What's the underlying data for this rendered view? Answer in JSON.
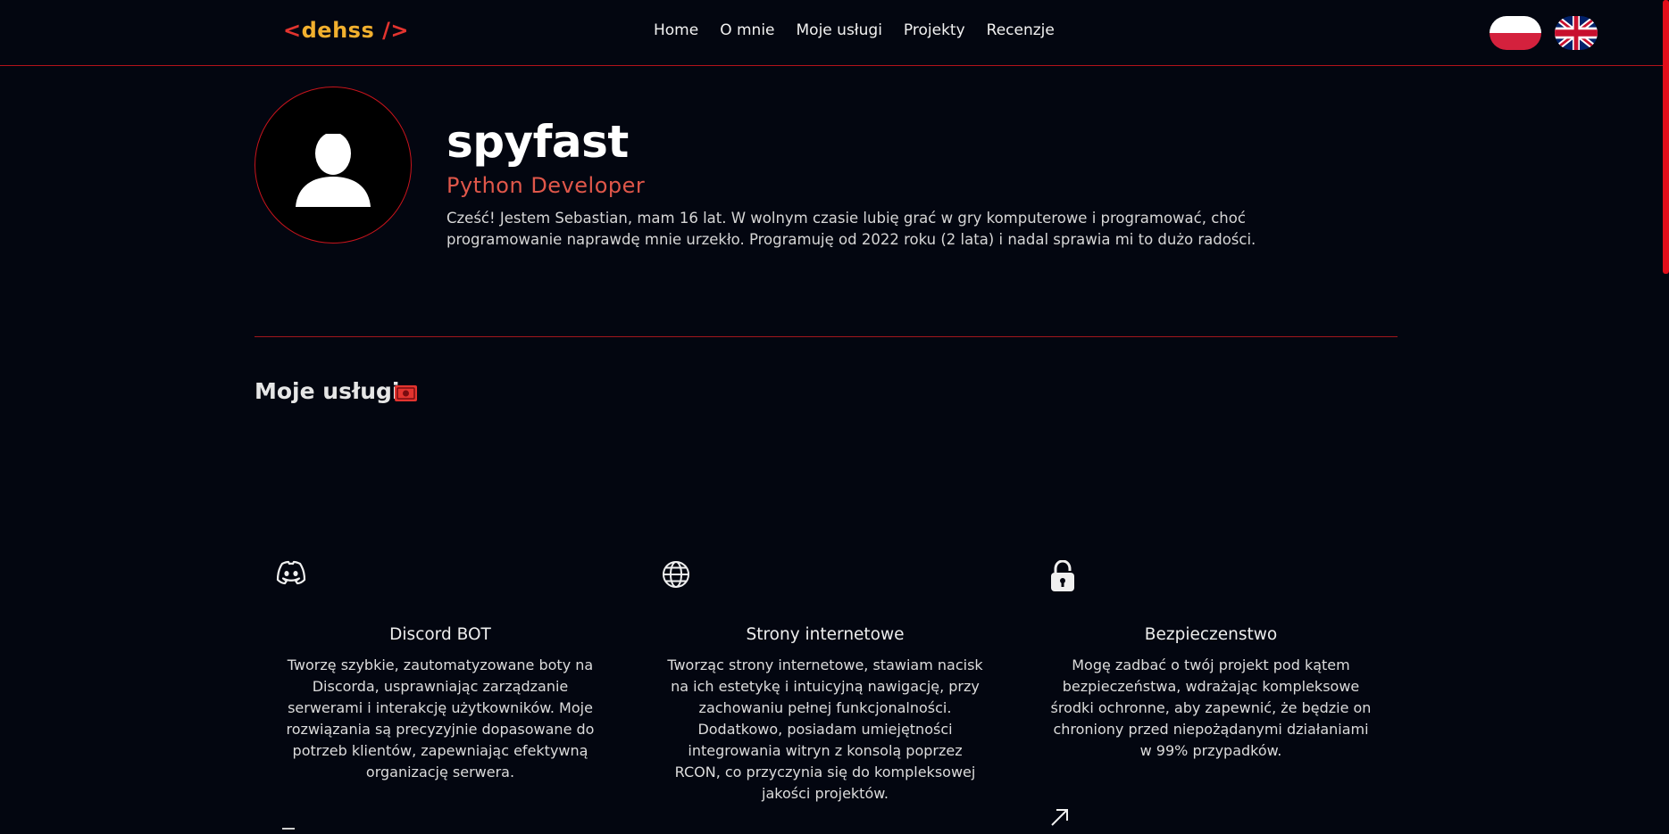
{
  "nav": {
    "logo_open": "<",
    "logo_name": "dehss",
    "logo_close": " />",
    "links": [
      "Home",
      "O mnie",
      "Moje usługi",
      "Projekty",
      "Recenzje"
    ],
    "languages": [
      "pl-flag-icon",
      "uk-flag-icon"
    ]
  },
  "profile": {
    "name": "spyfast",
    "role": "Python Developer",
    "bio": "Cześć! Jestem Sebastian, mam 16 lat. W wolnym czasie lubię grać w gry komputerowe i programować, choć programowanie naprawdę mnie urzekło. Programuję od 2022 roku (2 lata) i nadal sprawia mi to dużo radości."
  },
  "services": {
    "title": "Moje usługi",
    "icon": "money-icon",
    "items": [
      {
        "icon": "discord-icon",
        "title": "Discord BOT",
        "description": "Tworzę szybkie, zautomatyzowane boty na Discorda, usprawniając zarządzanie serwerami i interakcję użytkowników. Moje rozwiązania są precyzyjnie dopasowane do potrzeb klientów, zapewniając efektywną organizację serwera."
      },
      {
        "icon": "globe-icon",
        "title": "Strony internetowe",
        "description": "Tworząc strony internetowe, stawiam nacisk na ich estetykę i intuicyjną nawigację, przy zachowaniu pełnej funkcjonalności. Dodatkowo, posiadam umiejętności integrowania witryn z konsolą poprzez RCON, co przyczynia się do kompleksowej jakości projektów."
      },
      {
        "icon": "lock-icon",
        "title": "Bezpieczenstwo",
        "description": "Mogę zadbać o twój projekt pod kątem bezpieczeństwa, wdrażając kompleksowe środki ochronne, aby zapewnić, że będzie on chroniony przed niepożądanymi działaniami w 99% przypadków."
      }
    ]
  },
  "colors": {
    "background": "#030610",
    "accent_red": "#e3342f",
    "accent_gold": "#f2b02e",
    "role_color": "#e0574a"
  }
}
